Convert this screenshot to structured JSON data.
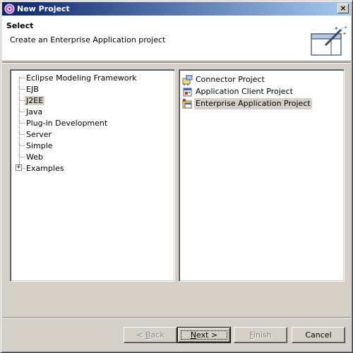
{
  "window": {
    "title": "New Project",
    "close_glyph": "×"
  },
  "banner": {
    "title": "Select",
    "description": "Create an Enterprise Application project",
    "icon": "new-project-wizard-icon"
  },
  "tree": {
    "items": [
      {
        "label": "Eclipse Modeling Framework",
        "selected": false,
        "expandable": false
      },
      {
        "label": "EJB",
        "selected": false,
        "expandable": false
      },
      {
        "label": "J2EE",
        "selected": true,
        "expandable": false
      },
      {
        "label": "Java",
        "selected": false,
        "expandable": false
      },
      {
        "label": "Plug-in Development",
        "selected": false,
        "expandable": false
      },
      {
        "label": "Server",
        "selected": false,
        "expandable": false
      },
      {
        "label": "Simple",
        "selected": false,
        "expandable": false
      },
      {
        "label": "Web",
        "selected": false,
        "expandable": false
      },
      {
        "label": "Examples",
        "selected": false,
        "expandable": true
      }
    ],
    "expander_glyph": "+"
  },
  "list": {
    "items": [
      {
        "label": "Connector Project",
        "icon": "connector-project-icon",
        "selected": false
      },
      {
        "label": "Application Client Project",
        "icon": "application-client-project-icon",
        "selected": false
      },
      {
        "label": "Enterprise Application Project",
        "icon": "enterprise-application-project-icon",
        "selected": true
      }
    ]
  },
  "buttons": {
    "back": {
      "prefix": "< ",
      "mnemonic": "B",
      "rest": "ack",
      "enabled": false
    },
    "next": {
      "prefix": "",
      "mnemonic": "N",
      "rest": "ext >",
      "enabled": true
    },
    "finish": {
      "prefix": "",
      "mnemonic": "F",
      "rest": "inish",
      "enabled": false
    },
    "cancel": {
      "label": "Cancel",
      "enabled": true
    }
  },
  "colors": {
    "title_gradient_start": "#0a246a",
    "title_gradient_end": "#a6caf0",
    "dialog_face": "#d4d0c8",
    "selection_bg": "#d4d0c8"
  }
}
